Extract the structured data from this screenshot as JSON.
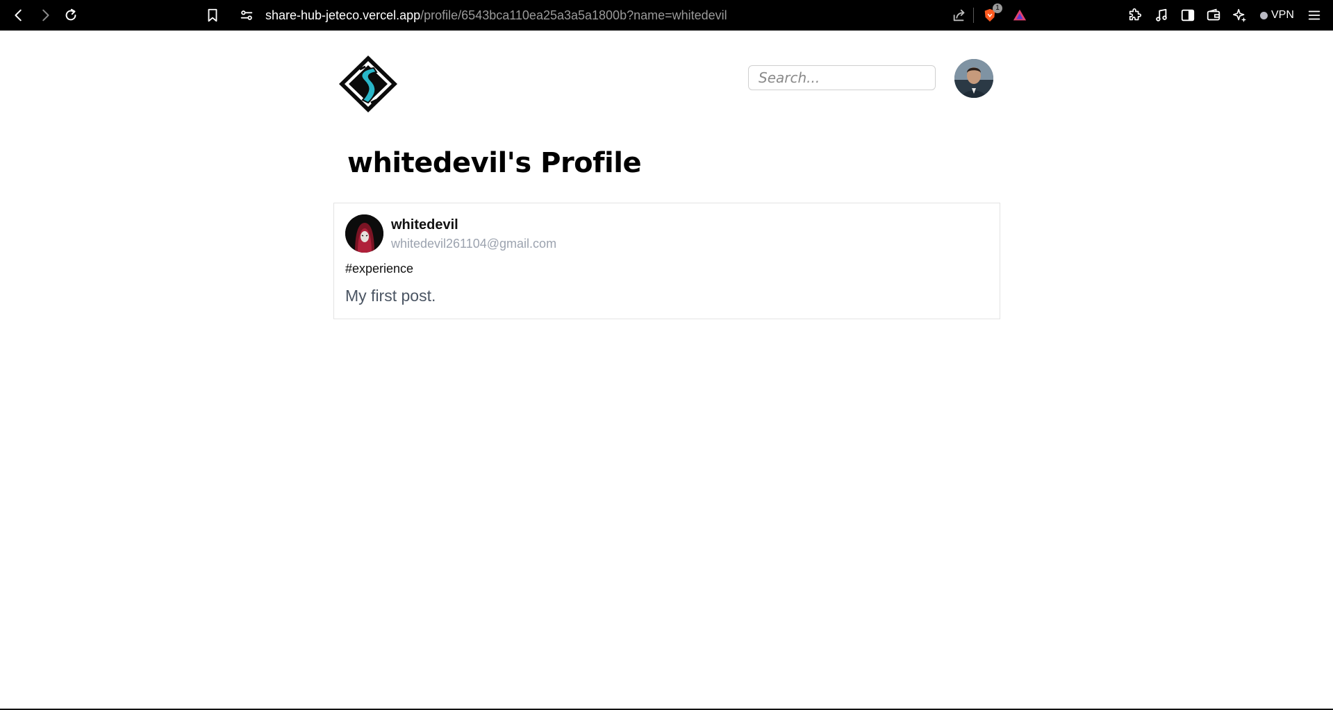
{
  "browser": {
    "url_host": "share-hub-jeteco.vercel.app",
    "url_path": "/profile/6543bca110ea25a3a5a1800b?name=whitedevil",
    "shields_count": "1",
    "vpn_label": "VPN",
    "icons": [
      "back-icon",
      "forward-icon",
      "reload-icon",
      "bookmark-icon",
      "site-settings-icon",
      "share-icon",
      "brave-shields-icon",
      "brave-rewards-icon",
      "extensions-icon",
      "media-icon",
      "sidebar-icon",
      "wallet-icon",
      "leo-ai-icon",
      "menu-icon"
    ]
  },
  "header": {
    "search_placeholder": "Search..."
  },
  "profile": {
    "title": "whitedevil's Profile"
  },
  "post": {
    "author_name": "whitedevil",
    "author_email": "whitedevil261104@gmail.com",
    "tag": "#experience",
    "body": "My first post."
  },
  "colors": {
    "chrome_bg": "#000000",
    "logo_teal": "#29b6c8",
    "email_gray": "#9ca3af",
    "body_gray": "#4b5563"
  }
}
